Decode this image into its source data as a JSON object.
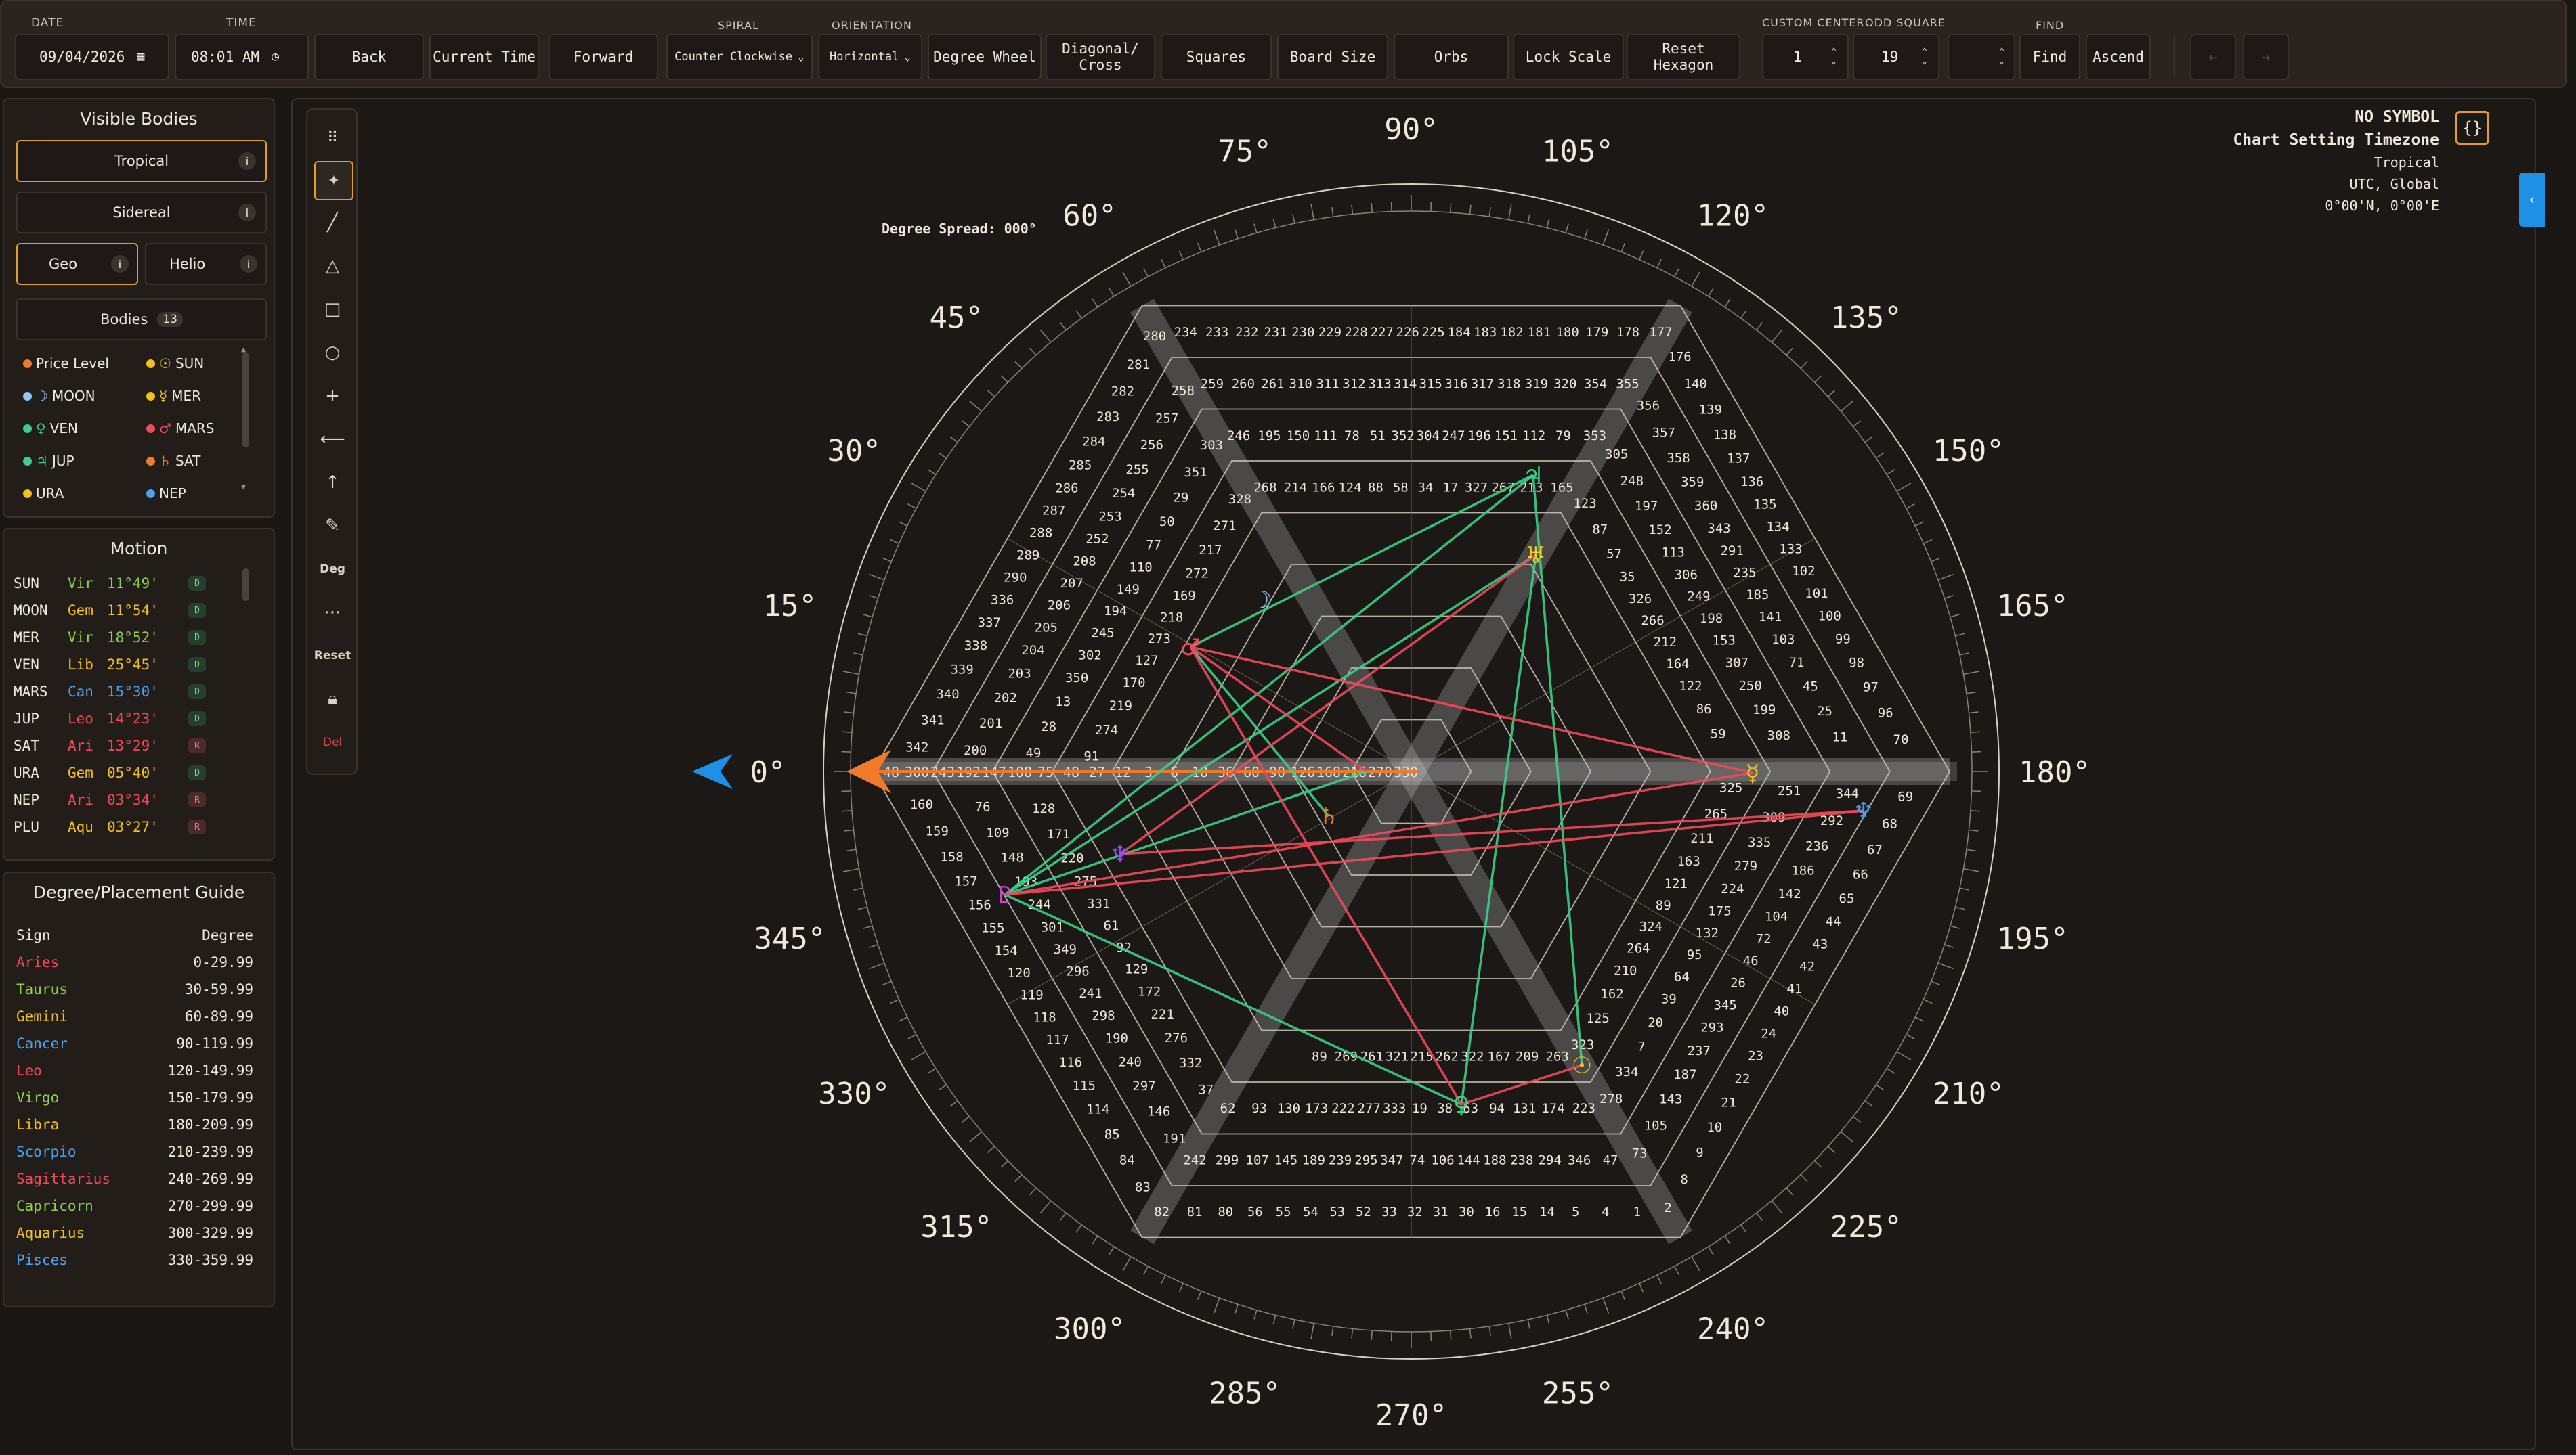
{
  "toolbar": {
    "date_label": "DATE",
    "date_value": "09/04/2026",
    "time_label": "TIME",
    "time_value": "08:01 AM",
    "back": "Back",
    "current_time": "Current Time",
    "forward": "Forward",
    "spiral_label": "SPIRAL",
    "spiral_value": "Counter Clockwise",
    "orientation_label": "ORIENTATION",
    "orientation_value": "Horizontal",
    "degree_wheel": "Degree Wheel",
    "diagonal_cross_1": "Diagonal/",
    "diagonal_cross_2": "Cross",
    "squares": "Squares",
    "board_size": "Board Size",
    "orbs": "Orbs",
    "lock_scale": "Lock Scale",
    "reset_hexagon": "Reset Hexagon",
    "custom_center_label": "CUSTOM CENTER",
    "custom_center_value": "1",
    "odd_square_label": "ODD SQUARE",
    "odd_square_value": "19",
    "find_label": "FIND",
    "find": "Find",
    "ascend": "Ascend"
  },
  "visible_bodies": {
    "title": "Visible Bodies",
    "tropical": "Tropical",
    "sidereal": "Sidereal",
    "geo": "Geo",
    "helio": "Helio",
    "info": "i",
    "bodies_label": "Bodies",
    "bodies_count": "13",
    "chips": [
      {
        "label": "Price Level",
        "glyph": "",
        "color": "#f07a2a"
      },
      {
        "label": "SUN",
        "glyph": "☉",
        "color": "#f0c020"
      },
      {
        "label": "MOON",
        "glyph": "☽",
        "color": "#8fc8f0"
      },
      {
        "label": "MER",
        "glyph": "☿",
        "color": "#f0c020"
      },
      {
        "label": "VEN",
        "glyph": "♀",
        "color": "#3ad08a"
      },
      {
        "label": "MARS",
        "glyph": "♂",
        "color": "#f04a5a"
      },
      {
        "label": "JUP",
        "glyph": "♃",
        "color": "#3ad08a"
      },
      {
        "label": "SAT",
        "glyph": "♄",
        "color": "#f07a2a"
      },
      {
        "label": "URA",
        "glyph": "",
        "color": "#f0c020"
      },
      {
        "label": "NEP",
        "glyph": "",
        "color": "#4aa0f0"
      }
    ]
  },
  "motion": {
    "title": "Motion",
    "rows": [
      {
        "body": "SUN",
        "sign": "Vir",
        "deg": "11°49'",
        "dir": "D",
        "color": "#8ad04a"
      },
      {
        "body": "MOON",
        "sign": "Gem",
        "deg": "11°54'",
        "dir": "D",
        "color": "#f0c020"
      },
      {
        "body": "MER",
        "sign": "Vir",
        "deg": "18°52'",
        "dir": "D",
        "color": "#8ad04a"
      },
      {
        "body": "VEN",
        "sign": "Lib",
        "deg": "25°45'",
        "dir": "D",
        "color": "#f0c020"
      },
      {
        "body": "MARS",
        "sign": "Can",
        "deg": "15°30'",
        "dir": "D",
        "color": "#4aa0f0"
      },
      {
        "body": "JUP",
        "sign": "Leo",
        "deg": "14°23'",
        "dir": "D",
        "color": "#f04a5a"
      },
      {
        "body": "SAT",
        "sign": "Ari",
        "deg": "13°29'",
        "dir": "R",
        "color": "#f04a5a"
      },
      {
        "body": "URA",
        "sign": "Gem",
        "deg": "05°40'",
        "dir": "D",
        "color": "#f0c020"
      },
      {
        "body": "NEP",
        "sign": "Ari",
        "deg": "03°34'",
        "dir": "R",
        "color": "#f04a5a"
      },
      {
        "body": "PLU",
        "sign": "Aqu",
        "deg": "03°27'",
        "dir": "R",
        "color": "#f0c020"
      }
    ]
  },
  "guide": {
    "title": "Degree/Placement Guide",
    "col_sign": "Sign",
    "col_degree": "Degree",
    "rows": [
      {
        "sign": "Aries",
        "range": "0-29.99",
        "color": "#f04a5a"
      },
      {
        "sign": "Taurus",
        "range": "30-59.99",
        "color": "#8ad04a"
      },
      {
        "sign": "Gemini",
        "range": "60-89.99",
        "color": "#f0c020"
      },
      {
        "sign": "Cancer",
        "range": "90-119.99",
        "color": "#4aa0f0"
      },
      {
        "sign": "Leo",
        "range": "120-149.99",
        "color": "#f04a5a"
      },
      {
        "sign": "Virgo",
        "range": "150-179.99",
        "color": "#8ad04a"
      },
      {
        "sign": "Libra",
        "range": "180-209.99",
        "color": "#f0c020"
      },
      {
        "sign": "Scorpio",
        "range": "210-239.99",
        "color": "#4aa0f0"
      },
      {
        "sign": "Sagittarius",
        "range": "240-269.99",
        "color": "#f04a5a"
      },
      {
        "sign": "Capricorn",
        "range": "270-299.99",
        "color": "#8ad04a"
      },
      {
        "sign": "Aquarius",
        "range": "300-329.99",
        "color": "#f0c020"
      },
      {
        "sign": "Pisces",
        "range": "330-359.99",
        "color": "#4aa0f0"
      }
    ]
  },
  "tools": {
    "deg": "Deg",
    "reset": "Reset",
    "del": "Del"
  },
  "chart": {
    "degree_spread": "Degree Spread: 000°",
    "no_symbol": "NO SYMBOL",
    "timezone_title": "Chart Setting Timezone",
    "zodiac": "Tropical",
    "tz": "UTC, Global",
    "coords": "0°00'N, 0°00'E",
    "json_icon": "{}",
    "degree_labels": [
      "0°",
      "15°",
      "30°",
      "45°",
      "60°",
      "75°",
      "90°",
      "105°",
      "120°",
      "135°",
      "150°",
      "165°",
      "180°",
      "195°",
      "210°",
      "225°",
      "240°",
      "255°",
      "270°",
      "285°",
      "300°",
      "315°",
      "330°",
      "345°"
    ],
    "axis_cells": [
      "48",
      "300",
      "243",
      "192",
      "147",
      "108",
      "75",
      "48",
      "27",
      "12",
      "3",
      "6",
      "18",
      "36",
      "60",
      "90",
      "126",
      "168",
      "216",
      "270",
      "330"
    ],
    "hex_cells": [
      "342",
      "341",
      "340",
      "339",
      "338",
      "337",
      "336",
      "290",
      "289",
      "288",
      "287",
      "286",
      "285",
      "284",
      "283",
      "282",
      "281",
      "280",
      "234",
      "233",
      "232",
      "231",
      "230",
      "229",
      "228",
      "227",
      "226",
      "225",
      "184",
      "183",
      "182",
      "181",
      "180",
      "179",
      "178",
      "177",
      "176",
      "140",
      "139",
      "138",
      "137",
      "136",
      "135",
      "134",
      "133",
      "102",
      "101",
      "100",
      "99",
      "98",
      "97",
      "96",
      "70",
      "69",
      "68",
      "67",
      "66",
      "65",
      "44",
      "43",
      "42",
      "41",
      "40",
      "24",
      "23",
      "22",
      "21",
      "10",
      "9",
      "8",
      "2",
      "1",
      "4",
      "5",
      "14",
      "15",
      "16",
      "30",
      "31",
      "32",
      "33",
      "52",
      "53",
      "54",
      "55",
      "56",
      "80",
      "81",
      "82",
      "83",
      "84",
      "85",
      "114",
      "115",
      "116",
      "117",
      "118",
      "119",
      "120",
      "154",
      "155",
      "156",
      "157",
      "158",
      "159",
      "160",
      "200",
      "201",
      "202",
      "203",
      "204",
      "205",
      "206",
      "207",
      "208",
      "252",
      "253",
      "254",
      "255",
      "256",
      "257",
      "258",
      "259",
      "260",
      "261",
      "310",
      "311",
      "312",
      "313",
      "314",
      "315",
      "316",
      "317",
      "318",
      "319",
      "320",
      "354",
      "355",
      "356",
      "357",
      "358",
      "359",
      "360",
      "343",
      "291",
      "235",
      "185",
      "141",
      "103",
      "71",
      "45",
      "25",
      "11",
      "344",
      "292",
      "236",
      "186",
      "142",
      "104",
      "72",
      "46",
      "26",
      "345",
      "293",
      "237",
      "187",
      "143",
      "105",
      "73",
      "47",
      "346",
      "294",
      "238",
      "188",
      "144",
      "106",
      "74",
      "347",
      "295",
      "239",
      "189",
      "145",
      "107",
      "299",
      "242",
      "191",
      "146",
      "297",
      "240",
      "190",
      "298",
      "241",
      "296",
      "349",
      "301",
      "244",
      "193",
      "148",
      "109",
      "76",
      "49",
      "28",
      "13",
      "350",
      "302",
      "245",
      "194",
      "149",
      "110",
      "77",
      "50",
      "29",
      "351",
      "303",
      "246",
      "195",
      "150",
      "111",
      "78",
      "51",
      "352",
      "304",
      "247",
      "196",
      "151",
      "112",
      "79",
      "353",
      "305",
      "248",
      "197",
      "152",
      "113",
      "306",
      "249",
      "198",
      "153",
      "307",
      "250",
      "199",
      "308",
      "251",
      "309",
      "335",
      "279",
      "224",
      "175",
      "132",
      "95",
      "64",
      "39",
      "20",
      "7",
      "334",
      "278",
      "223",
      "174",
      "131",
      "94",
      "63",
      "38",
      "19",
      "333",
      "277",
      "222",
      "173",
      "130",
      "93",
      "62",
      "37",
      "332",
      "276",
      "221",
      "172",
      "129",
      "92",
      "61",
      "331",
      "275",
      "220",
      "171",
      "128",
      "91",
      "274",
      "219",
      "170",
      "127",
      "273",
      "218",
      "169",
      "272",
      "217",
      "271",
      "328",
      "268",
      "214",
      "166",
      "124",
      "88",
      "58",
      "34",
      "17",
      "327",
      "267",
      "213",
      "165",
      "123",
      "87",
      "57",
      "35",
      "326",
      "266",
      "212",
      "164",
      "122",
      "86",
      "59",
      "325",
      "265",
      "211",
      "163",
      "121",
      "89",
      "324",
      "264",
      "210",
      "162",
      "125",
      "323",
      "263",
      "209",
      "167",
      "322",
      "262",
      "215",
      "321",
      "261",
      "269",
      "89"
    ],
    "planet_glyphs": [
      "☽",
      "♄",
      "♅",
      "♀",
      "☉",
      "☿",
      "♃",
      "♂",
      "♇",
      "♆",
      "♆"
    ]
  }
}
